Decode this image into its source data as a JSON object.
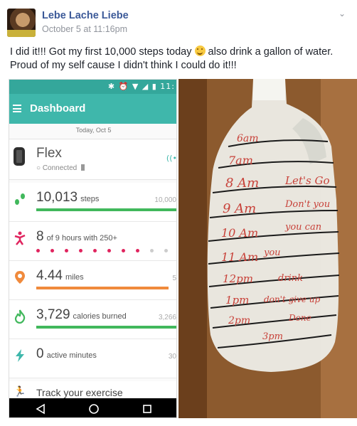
{
  "post": {
    "author": "Lebe Lache Liebe",
    "timestamp": "October 5 at 11:16pm",
    "text_before_emoji": "I did it!!! Got my first 10,000 steps today",
    "text_after_emoji": "also drink a gallon of water. Proud of my self cause I didn't think I could do it!!!",
    "emoji": "smiling-face-icon"
  },
  "phone": {
    "status_time": "11:",
    "status_icons": "✱ ⏰ ▼ ◢ ▮",
    "title": "Dashboard",
    "date": "Today, Oct 5",
    "device": {
      "name": "Flex",
      "status": "Connected"
    },
    "stats": {
      "steps": {
        "value": "10,013",
        "unit": "steps",
        "goal": "10,000",
        "progress": 1.0,
        "color": "#41b85c"
      },
      "hours": {
        "value": "8",
        "unit": "of 9 hours with 250+",
        "active_hours": 8,
        "total_hours": 9,
        "color": "#e0245e"
      },
      "miles": {
        "value": "4.44",
        "unit": "miles",
        "goal": "5",
        "progress": 0.888,
        "color": "#f08a3c"
      },
      "calories": {
        "value": "3,729",
        "unit": "calories burned",
        "goal": "3,266",
        "progress": 1.0,
        "color": "#41b85c"
      },
      "active": {
        "value": "0",
        "unit": "active minutes",
        "goal": "30"
      }
    },
    "track": "Track your exercise"
  },
  "photo": {
    "labels": [
      "6am",
      "7am",
      "8 Am",
      "9 Am",
      "10 Am",
      "11 Am",
      "12pm",
      "1pm",
      "2pm",
      "3pm"
    ],
    "notes": [
      "Let's Go",
      "Don't you",
      "you can",
      "you",
      "drink",
      "don't give up",
      "Done"
    ]
  }
}
